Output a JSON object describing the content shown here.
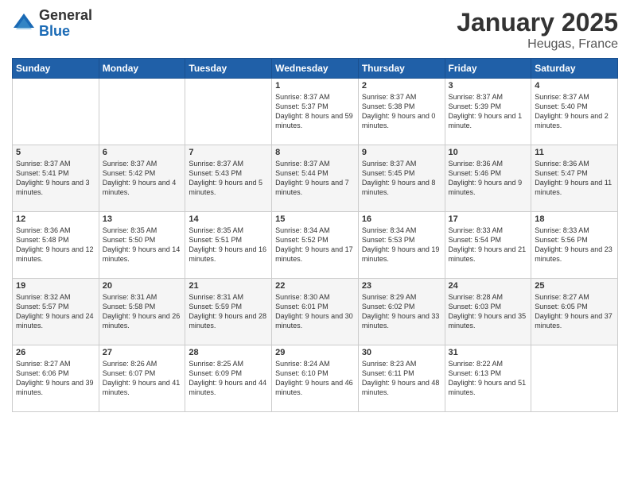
{
  "logo": {
    "general": "General",
    "blue": "Blue"
  },
  "header": {
    "month": "January 2025",
    "location": "Heugas, France"
  },
  "weekdays": [
    "Sunday",
    "Monday",
    "Tuesday",
    "Wednesday",
    "Thursday",
    "Friday",
    "Saturday"
  ],
  "weeks": [
    [
      {
        "day": "",
        "sunrise": "",
        "sunset": "",
        "daylight": ""
      },
      {
        "day": "",
        "sunrise": "",
        "sunset": "",
        "daylight": ""
      },
      {
        "day": "",
        "sunrise": "",
        "sunset": "",
        "daylight": ""
      },
      {
        "day": "1",
        "sunrise": "Sunrise: 8:37 AM",
        "sunset": "Sunset: 5:37 PM",
        "daylight": "Daylight: 8 hours and 59 minutes."
      },
      {
        "day": "2",
        "sunrise": "Sunrise: 8:37 AM",
        "sunset": "Sunset: 5:38 PM",
        "daylight": "Daylight: 9 hours and 0 minutes."
      },
      {
        "day": "3",
        "sunrise": "Sunrise: 8:37 AM",
        "sunset": "Sunset: 5:39 PM",
        "daylight": "Daylight: 9 hours and 1 minute."
      },
      {
        "day": "4",
        "sunrise": "Sunrise: 8:37 AM",
        "sunset": "Sunset: 5:40 PM",
        "daylight": "Daylight: 9 hours and 2 minutes."
      }
    ],
    [
      {
        "day": "5",
        "sunrise": "Sunrise: 8:37 AM",
        "sunset": "Sunset: 5:41 PM",
        "daylight": "Daylight: 9 hours and 3 minutes."
      },
      {
        "day": "6",
        "sunrise": "Sunrise: 8:37 AM",
        "sunset": "Sunset: 5:42 PM",
        "daylight": "Daylight: 9 hours and 4 minutes."
      },
      {
        "day": "7",
        "sunrise": "Sunrise: 8:37 AM",
        "sunset": "Sunset: 5:43 PM",
        "daylight": "Daylight: 9 hours and 5 minutes."
      },
      {
        "day": "8",
        "sunrise": "Sunrise: 8:37 AM",
        "sunset": "Sunset: 5:44 PM",
        "daylight": "Daylight: 9 hours and 7 minutes."
      },
      {
        "day": "9",
        "sunrise": "Sunrise: 8:37 AM",
        "sunset": "Sunset: 5:45 PM",
        "daylight": "Daylight: 9 hours and 8 minutes."
      },
      {
        "day": "10",
        "sunrise": "Sunrise: 8:36 AM",
        "sunset": "Sunset: 5:46 PM",
        "daylight": "Daylight: 9 hours and 9 minutes."
      },
      {
        "day": "11",
        "sunrise": "Sunrise: 8:36 AM",
        "sunset": "Sunset: 5:47 PM",
        "daylight": "Daylight: 9 hours and 11 minutes."
      }
    ],
    [
      {
        "day": "12",
        "sunrise": "Sunrise: 8:36 AM",
        "sunset": "Sunset: 5:48 PM",
        "daylight": "Daylight: 9 hours and 12 minutes."
      },
      {
        "day": "13",
        "sunrise": "Sunrise: 8:35 AM",
        "sunset": "Sunset: 5:50 PM",
        "daylight": "Daylight: 9 hours and 14 minutes."
      },
      {
        "day": "14",
        "sunrise": "Sunrise: 8:35 AM",
        "sunset": "Sunset: 5:51 PM",
        "daylight": "Daylight: 9 hours and 16 minutes."
      },
      {
        "day": "15",
        "sunrise": "Sunrise: 8:34 AM",
        "sunset": "Sunset: 5:52 PM",
        "daylight": "Daylight: 9 hours and 17 minutes."
      },
      {
        "day": "16",
        "sunrise": "Sunrise: 8:34 AM",
        "sunset": "Sunset: 5:53 PM",
        "daylight": "Daylight: 9 hours and 19 minutes."
      },
      {
        "day": "17",
        "sunrise": "Sunrise: 8:33 AM",
        "sunset": "Sunset: 5:54 PM",
        "daylight": "Daylight: 9 hours and 21 minutes."
      },
      {
        "day": "18",
        "sunrise": "Sunrise: 8:33 AM",
        "sunset": "Sunset: 5:56 PM",
        "daylight": "Daylight: 9 hours and 23 minutes."
      }
    ],
    [
      {
        "day": "19",
        "sunrise": "Sunrise: 8:32 AM",
        "sunset": "Sunset: 5:57 PM",
        "daylight": "Daylight: 9 hours and 24 minutes."
      },
      {
        "day": "20",
        "sunrise": "Sunrise: 8:31 AM",
        "sunset": "Sunset: 5:58 PM",
        "daylight": "Daylight: 9 hours and 26 minutes."
      },
      {
        "day": "21",
        "sunrise": "Sunrise: 8:31 AM",
        "sunset": "Sunset: 5:59 PM",
        "daylight": "Daylight: 9 hours and 28 minutes."
      },
      {
        "day": "22",
        "sunrise": "Sunrise: 8:30 AM",
        "sunset": "Sunset: 6:01 PM",
        "daylight": "Daylight: 9 hours and 30 minutes."
      },
      {
        "day": "23",
        "sunrise": "Sunrise: 8:29 AM",
        "sunset": "Sunset: 6:02 PM",
        "daylight": "Daylight: 9 hours and 33 minutes."
      },
      {
        "day": "24",
        "sunrise": "Sunrise: 8:28 AM",
        "sunset": "Sunset: 6:03 PM",
        "daylight": "Daylight: 9 hours and 35 minutes."
      },
      {
        "day": "25",
        "sunrise": "Sunrise: 8:27 AM",
        "sunset": "Sunset: 6:05 PM",
        "daylight": "Daylight: 9 hours and 37 minutes."
      }
    ],
    [
      {
        "day": "26",
        "sunrise": "Sunrise: 8:27 AM",
        "sunset": "Sunset: 6:06 PM",
        "daylight": "Daylight: 9 hours and 39 minutes."
      },
      {
        "day": "27",
        "sunrise": "Sunrise: 8:26 AM",
        "sunset": "Sunset: 6:07 PM",
        "daylight": "Daylight: 9 hours and 41 minutes."
      },
      {
        "day": "28",
        "sunrise": "Sunrise: 8:25 AM",
        "sunset": "Sunset: 6:09 PM",
        "daylight": "Daylight: 9 hours and 44 minutes."
      },
      {
        "day": "29",
        "sunrise": "Sunrise: 8:24 AM",
        "sunset": "Sunset: 6:10 PM",
        "daylight": "Daylight: 9 hours and 46 minutes."
      },
      {
        "day": "30",
        "sunrise": "Sunrise: 8:23 AM",
        "sunset": "Sunset: 6:11 PM",
        "daylight": "Daylight: 9 hours and 48 minutes."
      },
      {
        "day": "31",
        "sunrise": "Sunrise: 8:22 AM",
        "sunset": "Sunset: 6:13 PM",
        "daylight": "Daylight: 9 hours and 51 minutes."
      },
      {
        "day": "",
        "sunrise": "",
        "sunset": "",
        "daylight": ""
      }
    ]
  ]
}
